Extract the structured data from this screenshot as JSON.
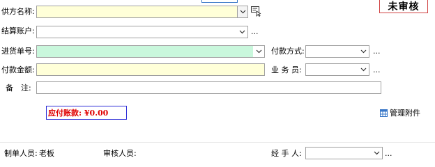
{
  "status": "未审核",
  "fields": {
    "supplier": {
      "label": "供方名称:",
      "value": ""
    },
    "account": {
      "label": "结算账户:",
      "value": "",
      "more": "..."
    },
    "purchase_no": {
      "label": "进货单号:",
      "value": ""
    },
    "payment_method": {
      "label": "付款方式:",
      "value": "",
      "more": "..."
    },
    "amount": {
      "label": "付款金额:",
      "value": ""
    },
    "salesperson": {
      "label": "业 务 员:",
      "value": "",
      "more": "..."
    },
    "remark": {
      "label": "备　注:",
      "value": ""
    }
  },
  "payable": "应付账款: ¥0.00",
  "attachment": {
    "label": "管理附件",
    "icon": "grid-icon"
  },
  "footer": {
    "creator_label": "制单人员:",
    "creator_value": "老板",
    "reviewer_label": "审核人员:",
    "reviewer_value": "",
    "handler": {
      "label": "经 手 人:",
      "value": "",
      "more": "..."
    }
  },
  "colors": {
    "yellow_field": "#ffffd8",
    "green_field": "#c9f7dc",
    "status_border": "#d04040",
    "payable_text": "#e00000",
    "payable_border": "#2b2bd6",
    "accent": "#3a78c8"
  }
}
